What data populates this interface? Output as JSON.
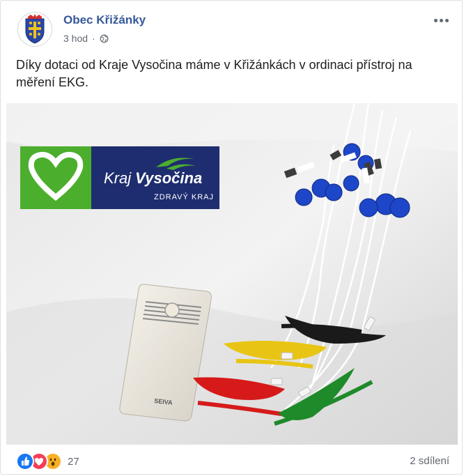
{
  "post": {
    "page_name": "Obec Křižánky",
    "time": "3 hod",
    "privacy_icon": "globe-icon",
    "more_icon": "more-options-icon",
    "text": "Díky dotaci od Kraje Vysočina máme v Křižánkách v ordinaci přístroj na měření EKG."
  },
  "photo": {
    "logo": {
      "brand_kraj": "Kraj",
      "brand_name": "Vysočina",
      "tagline": "ZDRAVÝ KRAJ"
    },
    "device_label": "SEIVA"
  },
  "footer": {
    "reactions": [
      "like-icon",
      "love-icon",
      "wow-icon"
    ],
    "reaction_count": "27",
    "shares": "2 sdílení"
  },
  "colors": {
    "link_blue": "#365899",
    "logo_navy": "#1e2d6f",
    "logo_green": "#4cae2d",
    "like_blue": "#1877f2",
    "love_red": "#f33e58",
    "wow_yellow": "#f7b125"
  }
}
